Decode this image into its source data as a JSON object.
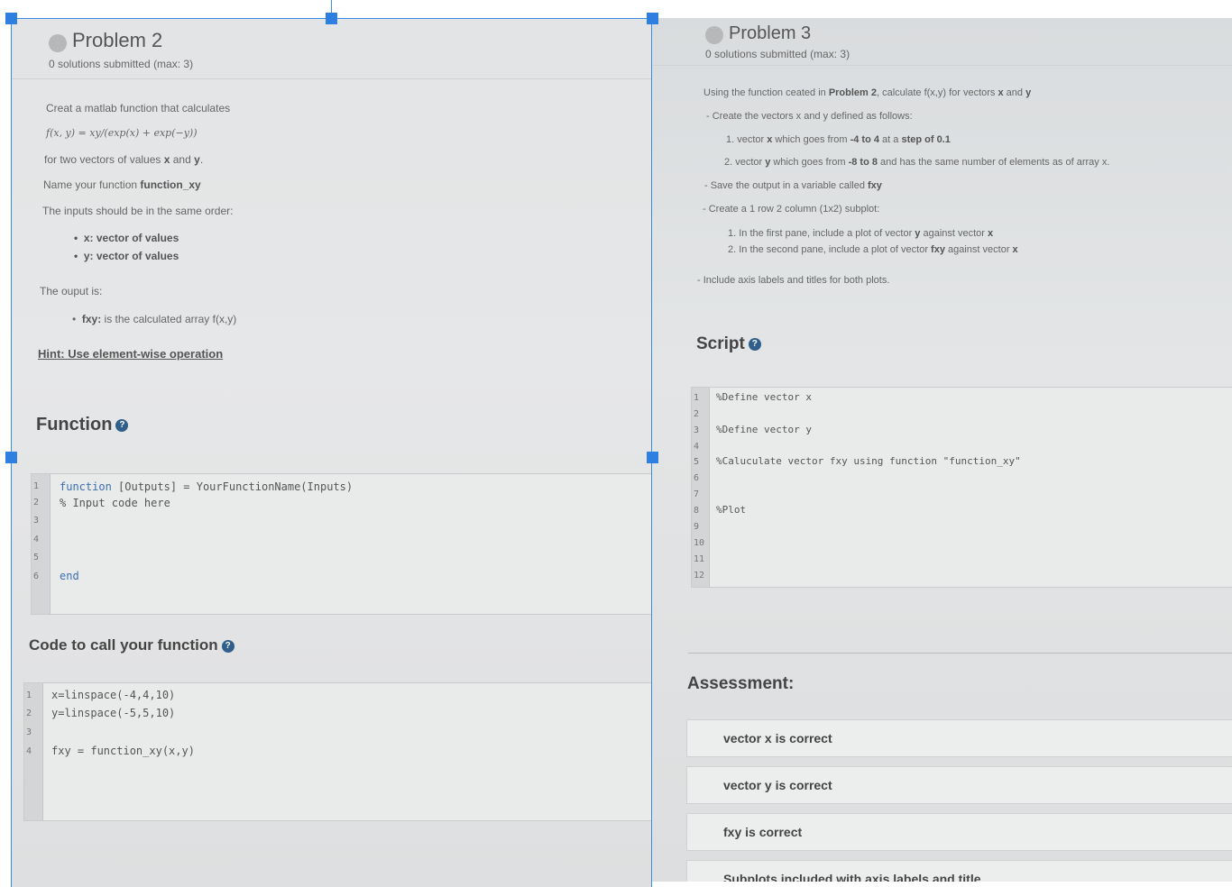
{
  "problem2": {
    "title": "Problem 2",
    "submitted": "0 solutions submitted (max: 3)",
    "intro": "Creat a matlab function that calculates",
    "formula": "f(x, y) = xy/(exp(x) + exp(−y))",
    "for_vectors_pre": "for two vectors of values ",
    "x": "x",
    "and": " and ",
    "y": "y",
    "period": ".",
    "name_pre": "Name your function ",
    "function_name": "function_xy",
    "inputs_line": "The inputs should be in the same order:",
    "input_items": [
      "x: vector of values",
      "y: vector of values"
    ],
    "output_line": "The ouput is:",
    "output_item_bold": "fxy:",
    "output_item_rest": " is the calculated array f(x,y)",
    "hint": "Hint: Use element-wise operation",
    "function_section": "Function",
    "function_code": {
      "line_numbers": [
        "1",
        "2",
        "3",
        "4",
        "5",
        "6"
      ],
      "line1_kw": "function",
      "line1_rest": " [Outputs] = YourFunctionName(Inputs)",
      "line2": "% Input code here",
      "line6_kw": "end"
    },
    "call_section": "Code to call your function",
    "call_code": {
      "line_numbers": [
        "1",
        "2",
        "3",
        "4"
      ],
      "lines": [
        "x=linspace(-4,4,10)",
        "y=linspace(-5,5,10)",
        "",
        "fxy = function_xy(x,y)"
      ]
    }
  },
  "problem3": {
    "title": "Problem 3",
    "submitted": "0 solutions submitted (max: 3)",
    "intro_pre": "Using the function ceated in ",
    "intro_ref": "Problem 2",
    "intro_mid": ", calculate f(x,y) for vectors ",
    "x": "x",
    "and": " and ",
    "y": "y",
    "create_vectors": "- Create the vectors x and y defined as follows:",
    "vector_x_pre": "1. vector ",
    "vector_x_mid": " which goes from ",
    "vector_x_range": "-4 to 4",
    "vector_x_at": " at a ",
    "vector_x_step": "step of 0.1",
    "vector_y_pre": "2. vector ",
    "vector_y_mid": " which goes from ",
    "vector_y_range": "-8 to 8",
    "vector_y_rest": " and has the same number of elements as of array x.",
    "save_pre": "- Save the output in a variable called ",
    "save_var": "fxy",
    "subplot_line": "- Create a 1 row 2 column (1x2) subplot:",
    "pane1_pre": "1. In the first pane, include a plot of vector ",
    "pane1_mid": " against vector ",
    "pane2_pre": "2. In the second pane, include a plot of vector ",
    "pane2_var": "fxy",
    "pane2_mid": " against vector ",
    "labels_line": "- Include axis labels and titles for both plots.",
    "script_section": "Script",
    "script_code": {
      "line_numbers": [
        "1",
        "2",
        "3",
        "4",
        "5",
        "6",
        "7",
        "8",
        "9",
        "10",
        "11",
        "12"
      ],
      "line1": "%Define vector x",
      "line3": "%Define vector y",
      "line5": "%Caluculate vector fxy using function \"function_xy\"",
      "line8": "%Plot"
    },
    "assessment_title": "Assessment:",
    "assessments": [
      "vector x is correct",
      "vector y is correct",
      "fxy is correct",
      "Subplots included with axis labels and title"
    ]
  },
  "colors": {
    "selection": "#2f7fe0",
    "info_icon": "#2f5f8a",
    "keyword": "#3a6fb2"
  }
}
